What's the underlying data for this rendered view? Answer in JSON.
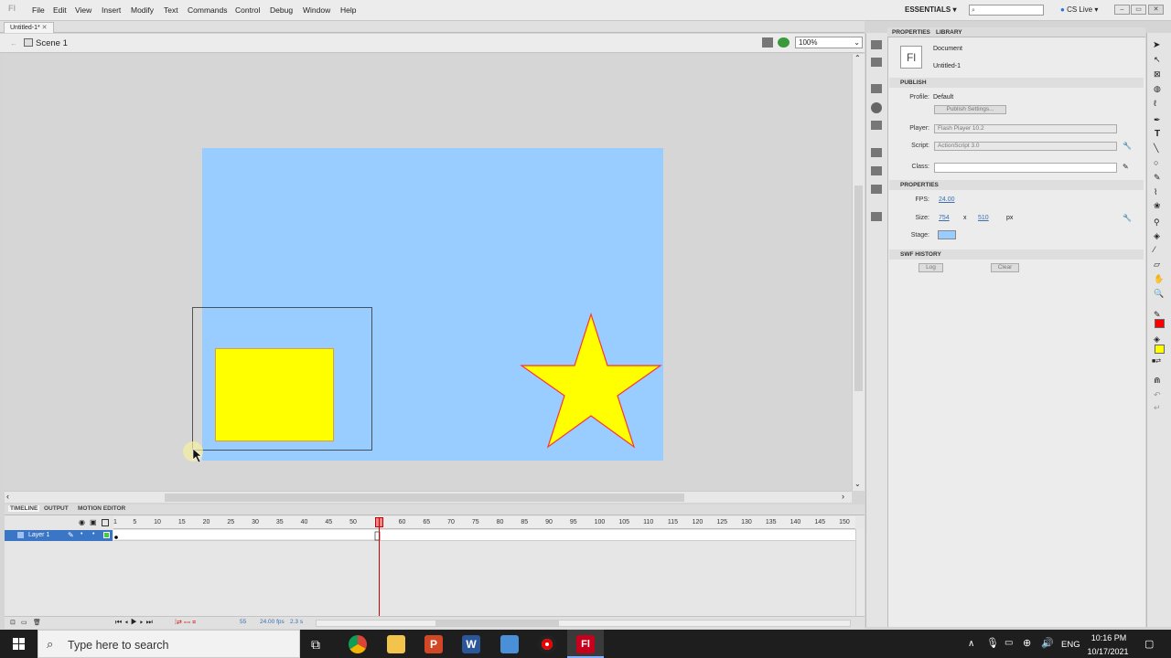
{
  "menubar": {
    "items": [
      "File",
      "Edit",
      "View",
      "Insert",
      "Modify",
      "Text",
      "Commands",
      "Control",
      "Debug",
      "Window",
      "Help"
    ],
    "workspace": "ESSENTIALS",
    "cs_live": "CS Live"
  },
  "document_tab": "Untitled-1*",
  "scene": "Scene 1",
  "zoom": "100%",
  "timeline": {
    "tabs": [
      "TIMELINE",
      "OUTPUT",
      "MOTION EDITOR"
    ],
    "frame_numbers": [
      "1",
      "5",
      "10",
      "15",
      "20",
      "25",
      "30",
      "35",
      "40",
      "45",
      "50",
      "55",
      "60",
      "65",
      "70",
      "75",
      "80",
      "85",
      "90",
      "95",
      "100",
      "105",
      "110",
      "115",
      "120",
      "125",
      "130",
      "135",
      "140",
      "145",
      "150"
    ],
    "layer_name": "Layer 1",
    "current_frame": "55",
    "fps": "24.00 fps",
    "elapsed": "2.3 s",
    "playhead_frame": 55
  },
  "properties": {
    "tabs": [
      "PROPERTIES",
      "LIBRARY"
    ],
    "doc_icon_text": "Fl",
    "doc_type": "Document",
    "doc_name": "Untitled-1",
    "publish": {
      "header": "PUBLISH",
      "profile_label": "Profile:",
      "profile_value": "Default",
      "publish_settings_button": "Publish Settings...",
      "player_label": "Player:",
      "player_value": "Flash Player 10.2",
      "script_label": "Script:",
      "script_value": "ActionScript 3.0",
      "class_label": "Class:"
    },
    "props": {
      "header": "PROPERTIES",
      "fps_label": "FPS:",
      "fps_value": "24.00",
      "size_label": "Size:",
      "width": "754",
      "x": "x",
      "height": "510",
      "unit": "px",
      "stage_label": "Stage:",
      "stage_color": "#99ccff"
    },
    "swf_history": {
      "header": "SWF HISTORY",
      "log_button": "Log",
      "clear_button": "Clear"
    }
  },
  "stage": {
    "shapes": {
      "rectangle_fill": "#ffff00",
      "star_fill": "#ffff00",
      "star_stroke": "#ff3333"
    }
  },
  "toolbox": {
    "stroke_color": "#ff0000",
    "fill_color": "#ffff00"
  },
  "taskbar": {
    "search_placeholder": "Type here to search",
    "language": "ENG",
    "time": "10:16 PM",
    "date": "10/17/2021"
  }
}
